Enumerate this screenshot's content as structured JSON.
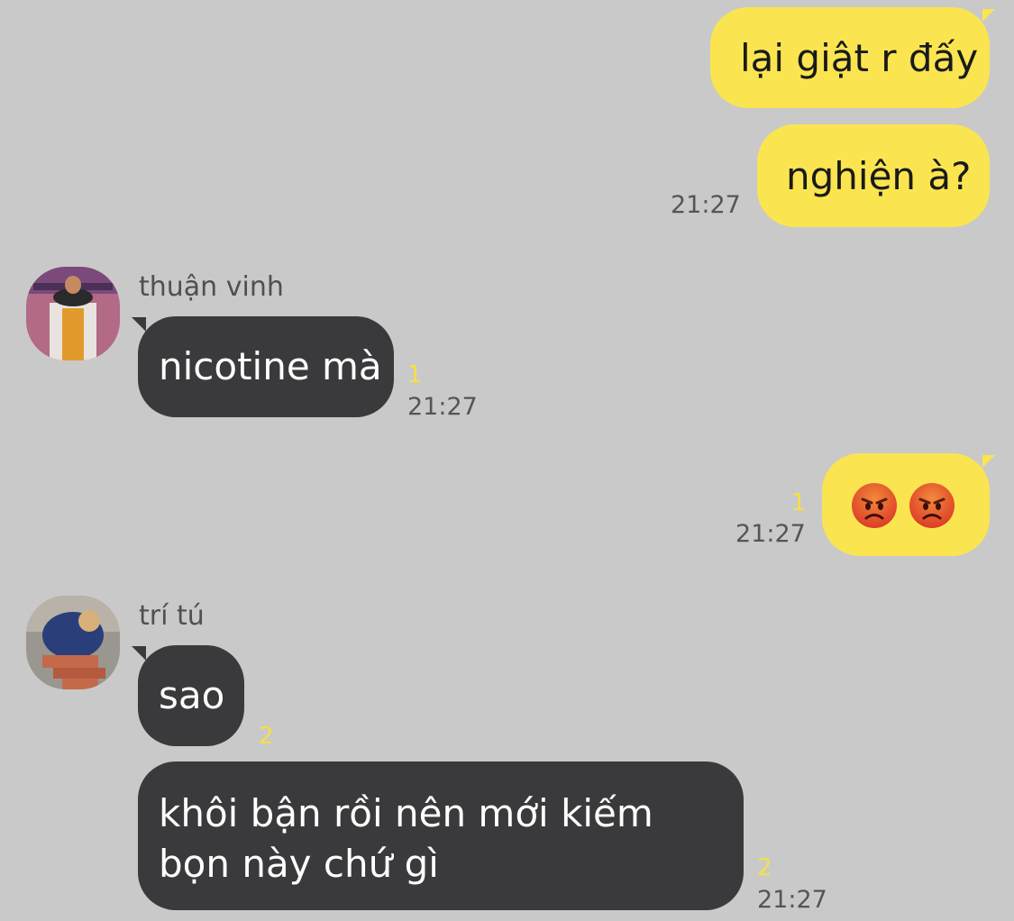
{
  "conversation": {
    "messages": [
      {
        "sender": "me",
        "text": "lại giật r đấy"
      },
      {
        "sender": "me",
        "text": "nghiện à?",
        "time": "21:27"
      },
      {
        "sender": "thuận vinh",
        "text": "nicotine mà",
        "unread": "1",
        "time": "21:27"
      },
      {
        "sender": "me",
        "emoji": [
          "angry-face",
          "angry-face"
        ],
        "unread": "1",
        "time": "21:27"
      },
      {
        "sender": "trí tú",
        "text": "sao",
        "unread": "2"
      },
      {
        "sender": "trí tú",
        "text": "khôi bận rồi nên mới kiếm bọn này chứ gì",
        "unread": "2",
        "time": "21:27"
      }
    ]
  },
  "colors": {
    "background": "#c9c9c9",
    "outgoing_bubble": "#fae550",
    "incoming_bubble": "#3a3a3c",
    "unread_count": "#f5e046"
  }
}
